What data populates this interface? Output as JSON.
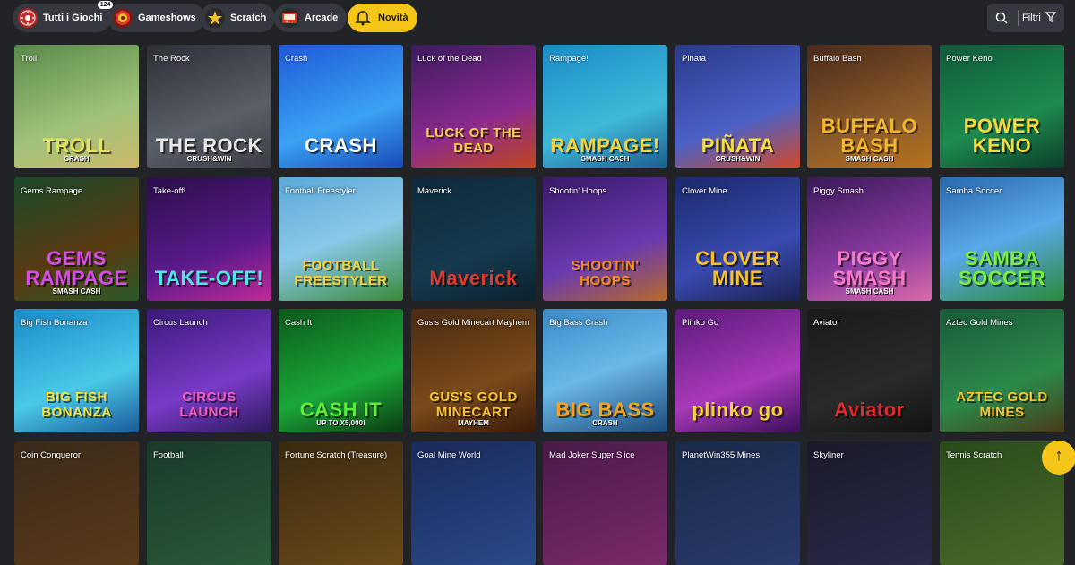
{
  "categories": [
    {
      "label": "Tutti i Giochi",
      "icon": "roulette-icon",
      "badge": "124",
      "active": false
    },
    {
      "label": "Gameshows",
      "icon": "wheel-icon",
      "active": false
    },
    {
      "label": "Scratch",
      "icon": "star-icon",
      "active": false
    },
    {
      "label": "Arcade",
      "icon": "arcade-icon",
      "active": false
    },
    {
      "label": "Novità",
      "icon": "bell-icon",
      "active": true
    }
  ],
  "filters": {
    "label": "Filtri",
    "search_icon": "search-icon",
    "filter_icon": "funnel-icon"
  },
  "colors": {
    "accent": "#f5c518",
    "background": "#212327",
    "pill": "#35383e"
  },
  "games": [
    {
      "name": "Troll",
      "logo": "TROLL",
      "sub": "CRASH",
      "bg": "linear-gradient(160deg,#5a8a4a,#9fc27a 60%,#cdb96a)",
      "fg": "#e6e35a"
    },
    {
      "name": "The Rock",
      "logo": "THE ROCK",
      "sub": "CRUSH&WIN",
      "bg": "linear-gradient(160deg,#2c2f36,#5b5f67 60%,#3a3d44)",
      "fg": "#e8e8e8"
    },
    {
      "name": "Crash",
      "logo": "CRASH",
      "sub": "",
      "bg": "linear-gradient(160deg,#1f5ad8,#3aa2f2 60%,#1a48b8)",
      "fg": "#ffffff"
    },
    {
      "name": "Luck of the Dead",
      "logo": "LUCK OF THE DEAD",
      "sub": "",
      "bg": "linear-gradient(160deg,#3b1b5e,#8b2a8f 60%,#c1461f)",
      "fg": "#f5d24a"
    },
    {
      "name": "Rampage!",
      "logo": "RAMPAGE!",
      "sub": "SMASH CASH",
      "bg": "linear-gradient(160deg,#1a8cc7,#3fb8d8 60%,#1b5e8e)",
      "fg": "#f7d236"
    },
    {
      "name": "Pinata",
      "logo": "PIÑATA",
      "sub": "CRUSH&WIN",
      "bg": "linear-gradient(160deg,#2a3a8a,#4b61c7 60%,#d14a2a)",
      "fg": "#f7e03a"
    },
    {
      "name": "Buffalo Bash",
      "logo": "BUFFALO BASH",
      "sub": "SMASH CASH",
      "bg": "linear-gradient(160deg,#4a2a1a,#8a5a2a 60%,#b8721f)",
      "fg": "#f5b72a"
    },
    {
      "name": "Power Keno",
      "logo": "POWER KENO",
      "sub": "",
      "bg": "linear-gradient(160deg,#0f5a3a,#1e8b4e 60%,#0c3d2a)",
      "fg": "#f7d93a"
    },
    {
      "name": "Gems Rampage",
      "logo": "GEMS RAMPAGE",
      "sub": "SMASH CASH",
      "bg": "linear-gradient(160deg,#1a4a2a,#5a3a12 60%,#2a5a2a)",
      "fg": "#d94aea"
    },
    {
      "name": "Take-off!",
      "logo": "TAKE-OFF!",
      "sub": "",
      "bg": "linear-gradient(160deg,#2a0f4a,#5a1a8a 60%,#c12a9a)",
      "fg": "#4ae8e8"
    },
    {
      "name": "Football Freestyler",
      "logo": "FOOTBALL FREESTYLER",
      "sub": "",
      "bg": "linear-gradient(160deg,#5aa8d8,#8ac8e8 50%,#3a8a3a)",
      "fg": "#f7d236"
    },
    {
      "name": "Maverick",
      "logo": "Maverick",
      "sub": "",
      "bg": "linear-gradient(160deg,#0f2a3a,#153a4e 60%,#0c2230)",
      "fg": "#e23a2a"
    },
    {
      "name": "Shootin' Hoops",
      "logo": "SHOOTIN' HOOPS",
      "sub": "",
      "bg": "linear-gradient(160deg,#3a1a6a,#6a3ab0 60%,#b86a2a)",
      "fg": "#f78a1a"
    },
    {
      "name": "Clover Mine",
      "logo": "CLOVER MINE",
      "sub": "",
      "bg": "linear-gradient(160deg,#1a2a6a,#3a4ab0 60%,#1a2250)",
      "fg": "#f7c22a"
    },
    {
      "name": "Piggy Smash",
      "logo": "PIGGY SMASH",
      "sub": "SMASH CASH",
      "bg": "linear-gradient(160deg,#3a1a5a,#8a3aa0 60%,#d86aa8)",
      "fg": "#f77ac8"
    },
    {
      "name": "Samba Soccer",
      "logo": "SAMBA SOCCER",
      "sub": "",
      "bg": "linear-gradient(160deg,#2a6ab0,#5aa8e8 50%,#2a8a3a)",
      "fg": "#7af03a"
    },
    {
      "name": "Big Fish Bonanza",
      "logo": "BIG FISH BONANZA",
      "sub": "",
      "bg": "linear-gradient(160deg,#1a8ac8,#4ac8e8 60%,#1a5a9a)",
      "fg": "#f7e03a"
    },
    {
      "name": "Circus Launch",
      "logo": "CIRCUS LAUNCH",
      "sub": "",
      "bg": "linear-gradient(160deg,#3a1a7a,#7a3ac8 60%,#2a1a5a)",
      "fg": "#f75ab8"
    },
    {
      "name": "Cash It",
      "logo": "CASH IT",
      "sub": "UP TO X5,000!",
      "bg": "linear-gradient(160deg,#0c5a1a,#1aa83a 60%,#0c3a12)",
      "fg": "#5af03a"
    },
    {
      "name": "Gus's Gold Minecart Mayhem",
      "logo": "GUS'S GOLD MINECART",
      "sub": "MAYHEM",
      "bg": "linear-gradient(160deg,#4a2a12,#7a4a1a 60%,#3a1a0a)",
      "fg": "#f7c22a"
    },
    {
      "name": "Big Bass Crash",
      "logo": "BIG BASS",
      "sub": "CRASH",
      "bg": "linear-gradient(160deg,#3a8ac8,#6ab8e8 50%,#1a4a7a)",
      "fg": "#f7a21a"
    },
    {
      "name": "Plinko Go",
      "logo": "plinko go",
      "sub": "",
      "bg": "linear-gradient(160deg,#5a1a7a,#a83ab8 60%,#3a0f5a)",
      "fg": "#f7d236"
    },
    {
      "name": "Aviator",
      "logo": "Aviator",
      "sub": "",
      "bg": "linear-gradient(160deg,#1a1a1a,#2a2a2a 60%,#121212)",
      "fg": "#e22a2a"
    },
    {
      "name": "Aztec Gold Mines",
      "logo": "AZTEC GOLD MINES",
      "sub": "",
      "bg": "linear-gradient(160deg,#1a5a3a,#2a8a4a 60%,#4a3a1a)",
      "fg": "#f7c22a"
    },
    {
      "name": "Coin Conqueror",
      "logo": "",
      "sub": "",
      "bg": "linear-gradient(160deg,#3a2a1a,#5a3a1a)",
      "fg": "#fff"
    },
    {
      "name": "Football",
      "logo": "",
      "sub": "",
      "bg": "linear-gradient(160deg,#1a3a2a,#2a5a3a)",
      "fg": "#fff"
    },
    {
      "name": "Fortune Scratch (Treasure)",
      "logo": "",
      "sub": "",
      "bg": "linear-gradient(160deg,#3a2a0f,#6a4a1a)",
      "fg": "#fff"
    },
    {
      "name": "Goal Mine World",
      "logo": "",
      "sub": "",
      "bg": "linear-gradient(160deg,#1a2a5a,#2a4a8a)",
      "fg": "#fff"
    },
    {
      "name": "Mad Joker Super Slice",
      "logo": "",
      "sub": "",
      "bg": "linear-gradient(160deg,#4a1a4a,#7a2a6a)",
      "fg": "#fff"
    },
    {
      "name": "PlanetWin355 Mines",
      "logo": "",
      "sub": "",
      "bg": "linear-gradient(160deg,#1a2a4a,#2a3a6a)",
      "fg": "#fff"
    },
    {
      "name": "Skyliner",
      "logo": "",
      "sub": "",
      "bg": "linear-gradient(160deg,#1a1a2a,#2a2a4a)",
      "fg": "#fff"
    },
    {
      "name": "Tennis Scratch",
      "logo": "",
      "sub": "",
      "bg": "linear-gradient(160deg,#2a4a1a,#4a6a2a)",
      "fg": "#fff"
    }
  ],
  "scroll_top_icon": "arrow-up-icon"
}
